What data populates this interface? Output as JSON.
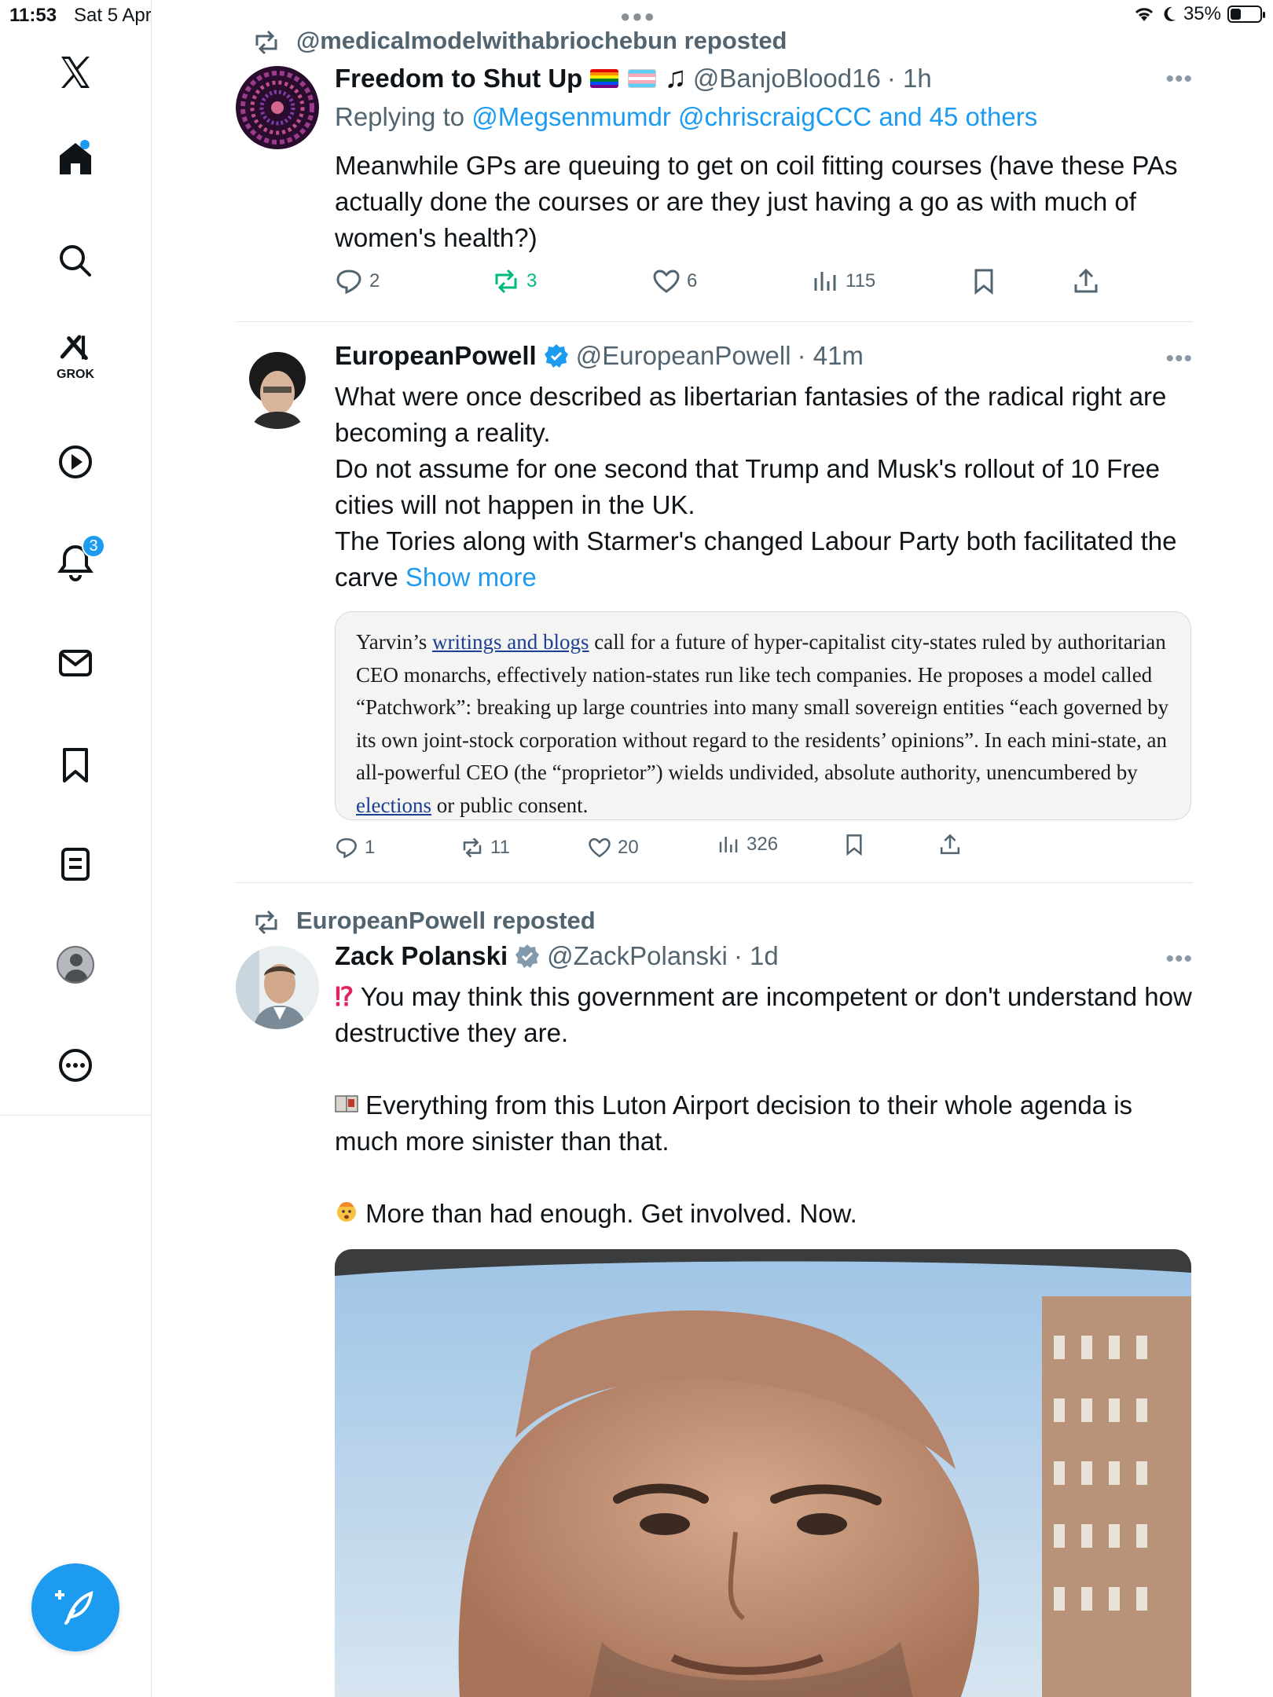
{
  "status": {
    "time": "11:53",
    "date": "Sat 5 Apr",
    "battery": "35%",
    "battery_level": 0.35
  },
  "sidebar": {
    "items": [
      "x-logo-icon",
      "home-icon",
      "search-icon",
      "grok-icon",
      "video-icon",
      "notifications-icon",
      "messages-icon",
      "bookmarks-icon",
      "lists-icon",
      "profile-icon",
      "more-icon"
    ],
    "grok_label": "GROK",
    "notifications_count": "3"
  },
  "tweets": [
    {
      "repost_by": "@medicalmodelwithabriochebun reposted",
      "name": "Freedom to Shut Up",
      "handle": "@BanjoBlood16",
      "time": "· 1h",
      "reply_prefix": "Replying to ",
      "reply_users": "@Megsenmumdr @chriscraigCCC and 45 others",
      "text": "Meanwhile GPs are queuing to get on coil fitting courses (have these PAs actually done the courses or are they just having a go as with much of women's health?)",
      "replies": "2",
      "reposts": "3",
      "likes": "6",
      "views": "115"
    },
    {
      "name": "EuropeanPowell",
      "handle": "@EuropeanPowell",
      "time": "· 41m",
      "text_lines": [
        "What were once described as libertarian fantasies of the radical right are becoming a reality.",
        "Do not assume for one second that Trump and Musk's rollout of 10 Free cities will not happen in the UK.",
        "The Tories along with Starmer's changed Labour Party both facilitated the carve "
      ],
      "show_more": "Show more",
      "quote": {
        "part1": "Yarvin’s ",
        "link1": "writings and blogs",
        "part2": " call for a future of hyper-capitalist city-states ruled by authoritarian CEO monarchs, effectively nation-states run like tech companies. He proposes a model called “Patchwork”: breaking up large countries into many small sovereign entities “each governed by its own joint-stock corporation without regard to the residents’ opinions”. In each mini-state, an all-powerful CEO (the “proprietor”) wields undivided, absolute authority, unencumbered by ",
        "link2": "elections",
        "part3": " or public consent."
      },
      "replies": "1",
      "reposts": "11",
      "likes": "20",
      "views": "326"
    },
    {
      "repost_by": "EuropeanPowell reposted",
      "name": "Zack Polanski",
      "handle": "@ZackPolanski",
      "time": "· 1d",
      "para1": " You may think this government are incompetent or don't understand how destructive they are.",
      "para2": " Everything from this Luton Airport decision to their whole agenda is much more sinister than that.",
      "para3": " More than had enough. Get involved. Now."
    }
  ],
  "colors": {
    "accent": "#1d9bf0",
    "repost_green": "#00ba7c",
    "secondary": "#536471"
  }
}
